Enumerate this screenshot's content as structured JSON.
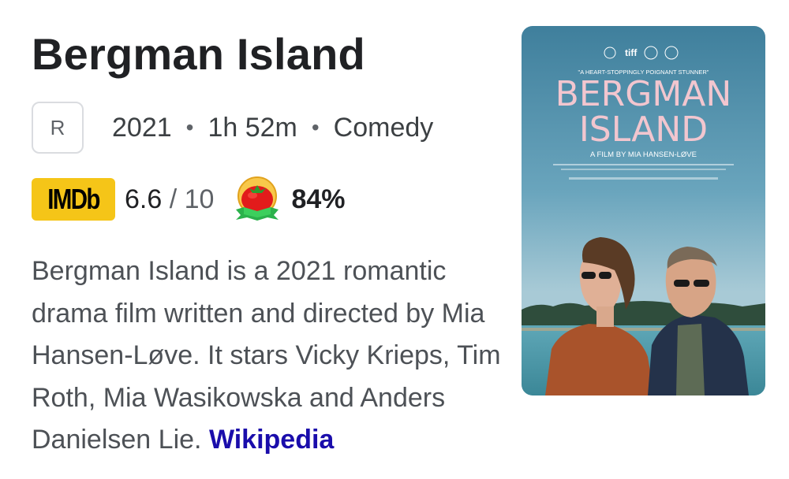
{
  "movie": {
    "title": "Bergman Island",
    "rating": "R",
    "year": "2021",
    "runtime": "1h 52m",
    "genre": "Comedy",
    "meta_separator": "•",
    "imdb": {
      "logo_text": "IMDb",
      "score": "6.6",
      "out_of": "/ 10"
    },
    "rotten_tomatoes": {
      "score": "84%"
    },
    "description": "Bergman Island is a 2021 romantic drama film written and directed by Mia Hansen-Løve. It stars Vicky Krieps, Tim Roth, Mia Wasikowska and Anders Danielsen Lie.",
    "source_link": "Wikipedia"
  },
  "poster": {
    "festival_logo": "tiff",
    "quote": "\"A HEART-STOPPINGLY POIGNANT STUNNER\"",
    "title_line1": "BERGMAN",
    "title_line2": "ISLAND",
    "credit": "A FILM BY MIA HANSEN-LØVE"
  },
  "colors": {
    "imdb_yellow": "#f5c518",
    "link_blue": "#1a0dab",
    "poster_title_pink": "#f2c6cf"
  },
  "icons": {
    "imdb": "imdb-logo",
    "tomato": "fresh-tomato-icon"
  }
}
